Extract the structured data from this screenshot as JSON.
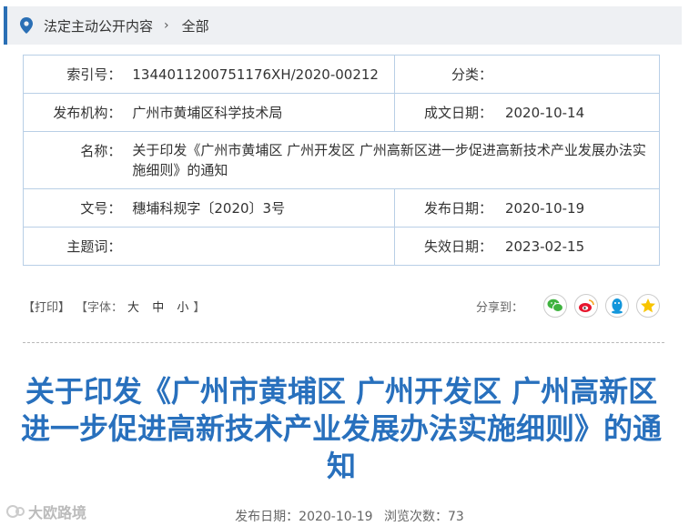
{
  "breadcrumb": {
    "items": [
      "法定主动公开内容",
      "全部"
    ],
    "separator": "›"
  },
  "meta": {
    "index_label": "索引号：",
    "index_value": "1344011200751176XH/2020-00212",
    "category_label": "分类：",
    "category_value": "",
    "publisher_label": "发布机构：",
    "publisher_value": "广州市黄埔区科学技术局",
    "created_label": "成文日期：",
    "created_value": "2020-10-14",
    "name_label": "名称：",
    "name_value": "关于印发《广州市黄埔区 广州开发区 广州高新区进一步促进高新技术产业发展办法实施细则》的通知",
    "doc_no_label": "文号：",
    "doc_no_value": "穗埔科规字〔2020〕3号",
    "publish_date_label": "发布日期：",
    "publish_date_value": "2020-10-19",
    "subject_label": "主题词：",
    "subject_value": "",
    "expiry_label": "失效日期：",
    "expiry_value": "2023-02-15"
  },
  "toolbar": {
    "print": "【打印】",
    "font_open": "【字体：",
    "sizes": [
      "大",
      "中",
      "小"
    ],
    "font_close": "】",
    "share_label": "分享到：",
    "share_icons": [
      "wechat-icon",
      "weibo-icon",
      "qq-icon",
      "qzone-icon"
    ]
  },
  "article": {
    "title": "关于印发《广州市黄埔区 广州开发区 广州高新区进一步促进高新技术产业发展办法实施细则》的通知",
    "publish_date": "发布日期：2020-10-19",
    "views": "浏览次数：73"
  },
  "watermark": "大欧路境",
  "colors": {
    "accent": "#2a6fb5",
    "title": "#2870bd",
    "table_border": "#b9cfe6",
    "breadcrumb_bg": "#eef0f3"
  }
}
